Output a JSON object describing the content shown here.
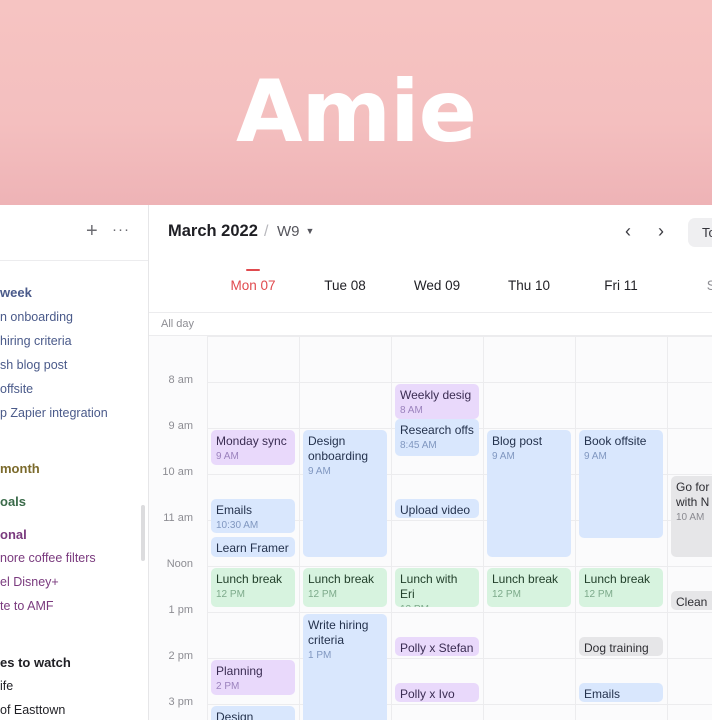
{
  "hero": {
    "title": "Amie"
  },
  "sidebar": {
    "groups": [
      {
        "label": "week",
        "color": "#4a5a8a",
        "items": [
          {
            "label": "n onboarding"
          },
          {
            "label": "hiring criteria"
          },
          {
            "label": "sh blog post"
          },
          {
            "label": "offsite"
          },
          {
            "label": "p Zapier integration"
          }
        ]
      },
      {
        "label": "month",
        "color": "#7b6a2b",
        "items": []
      },
      {
        "label": "oals",
        "color": "#3b6b4a",
        "items": []
      },
      {
        "label": "onal",
        "color": "#7a3a7e",
        "items": [
          {
            "label": "nore coffee filters"
          },
          {
            "label": "el Disney+"
          },
          {
            "label": "te to AMF"
          }
        ]
      },
      {
        "label": "es to watch",
        "color": "#1f1f24",
        "items": [
          {
            "label": "ife"
          },
          {
            "label": "of Easttown"
          }
        ]
      }
    ]
  },
  "header": {
    "month": "March 2022",
    "separator": "/",
    "week": "W9",
    "today_button": "To"
  },
  "days": [
    {
      "label": "Mon 07",
      "today": true
    },
    {
      "label": "Tue 08"
    },
    {
      "label": "Wed 09"
    },
    {
      "label": "Thu 10"
    },
    {
      "label": "Fri 11"
    },
    {
      "label": "Sat"
    }
  ],
  "allday_label": "All day",
  "times": [
    "8 am",
    "9 am",
    "10 am",
    "11 am",
    "Noon",
    "1 pm",
    "2 pm",
    "3 pm"
  ],
  "events": [
    {
      "day": 2,
      "start": 8.0,
      "end": 8.8,
      "title": "Weekly desig",
      "time": "8 AM",
      "color": "purple"
    },
    {
      "day": 2,
      "start": 8.75,
      "end": 9.6,
      "title": "Research offs",
      "time": "8:45 AM",
      "color": "blue"
    },
    {
      "day": 0,
      "start": 9.0,
      "end": 9.8,
      "title": "Monday sync",
      "time": "9 AM",
      "color": "purple"
    },
    {
      "day": 1,
      "start": 9.0,
      "end": 11.8,
      "title": "Design onboarding",
      "time": "9 AM",
      "color": "blue"
    },
    {
      "day": 3,
      "start": 9.0,
      "end": 11.8,
      "title": "Blog post",
      "time": "9 AM",
      "color": "blue"
    },
    {
      "day": 4,
      "start": 9.0,
      "end": 11.4,
      "title": "Book offsite",
      "time": "9 AM",
      "color": "blue"
    },
    {
      "day": 5,
      "start": 10.0,
      "end": 11.8,
      "title": "Go for with N",
      "time": "10 AM",
      "color": "gray"
    },
    {
      "day": 2,
      "start": 10.5,
      "end": 10.95,
      "title": "Upload video",
      "time": "",
      "color": "blue"
    },
    {
      "day": 0,
      "start": 10.5,
      "end": 11.28,
      "title": "Emails",
      "time": "10:30 AM",
      "color": "blue"
    },
    {
      "day": 0,
      "start": 11.33,
      "end": 11.8,
      "title": "Learn Framer",
      "time": "",
      "color": "blue"
    },
    {
      "day": 0,
      "start": 12.0,
      "end": 12.9,
      "title": "Lunch break",
      "time": "12 PM",
      "color": "green"
    },
    {
      "day": 1,
      "start": 12.0,
      "end": 12.9,
      "title": "Lunch break",
      "time": "12 PM",
      "color": "green"
    },
    {
      "day": 2,
      "start": 12.0,
      "end": 12.9,
      "title": "Lunch with Eri",
      "time": "12 PM",
      "color": "green"
    },
    {
      "day": 3,
      "start": 12.0,
      "end": 12.9,
      "title": "Lunch break",
      "time": "12 PM",
      "color": "green"
    },
    {
      "day": 4,
      "start": 12.0,
      "end": 12.9,
      "title": "Lunch break",
      "time": "12 PM",
      "color": "green"
    },
    {
      "day": 5,
      "start": 12.5,
      "end": 12.95,
      "title": "Clean",
      "time": "",
      "color": "gray"
    },
    {
      "day": 1,
      "start": 13.0,
      "end": 16.0,
      "title": "Write hiring criteria",
      "time": "1 PM",
      "color": "blue"
    },
    {
      "day": 2,
      "start": 13.5,
      "end": 13.95,
      "title": "Polly x Stefan",
      "time": "",
      "color": "purple"
    },
    {
      "day": 4,
      "start": 13.5,
      "end": 13.95,
      "title": "Dog training",
      "time": "",
      "color": "gray"
    },
    {
      "day": 0,
      "start": 14.0,
      "end": 14.8,
      "title": "Planning",
      "time": "2 PM",
      "color": "purple"
    },
    {
      "day": 2,
      "start": 14.5,
      "end": 14.95,
      "title": "Polly x Ivo",
      "time": "",
      "color": "purple"
    },
    {
      "day": 4,
      "start": 14.5,
      "end": 14.95,
      "title": "Emails",
      "time": "",
      "color": "blue"
    },
    {
      "day": 0,
      "start": 15.0,
      "end": 16.0,
      "title": "Design",
      "time": "",
      "color": "blue"
    }
  ]
}
